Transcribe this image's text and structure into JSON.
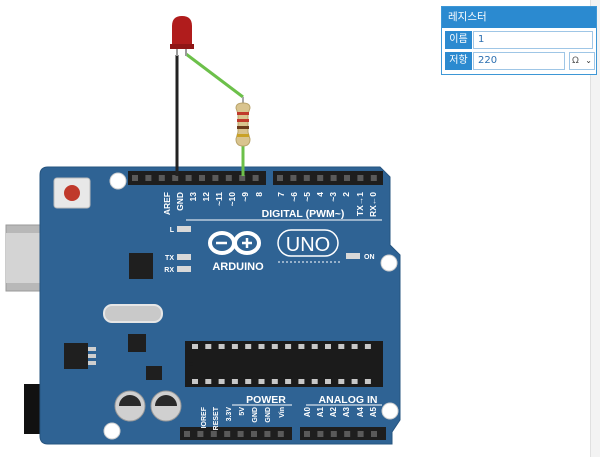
{
  "panel": {
    "title": "레지스터",
    "name_label": "이름",
    "name_value": "1",
    "resistance_label": "저항",
    "resistance_value": "220",
    "unit": "Ω"
  },
  "board": {
    "brand": "ARDUINO",
    "model": "UNO",
    "digital_header": "DIGITAL (PWM~)",
    "power_header": "POWER",
    "analog_header": "ANALOG IN",
    "on_label": "ON",
    "l_label": "L",
    "tx_label": "TX",
    "rx_label": "RX",
    "digital_pins": [
      "AREF",
      "GND",
      "13",
      "12",
      "~11",
      "~10",
      "~9",
      "8",
      "7",
      "~6",
      "~5",
      "4",
      "~3",
      "2",
      "TX→1",
      "RX←0"
    ],
    "power_pins": [
      "IOREF",
      "RESET",
      "3.3V",
      "5V",
      "GND",
      "GND",
      "Vin"
    ],
    "analog_pins": [
      "A0",
      "A1",
      "A2",
      "A3",
      "A4",
      "A5"
    ]
  },
  "colors": {
    "board": "#2f6394",
    "panel_accent": "#2b8ad0",
    "wire_green": "#6cc04a",
    "wire_black": "#222222",
    "led_red": "#b01c1c"
  }
}
